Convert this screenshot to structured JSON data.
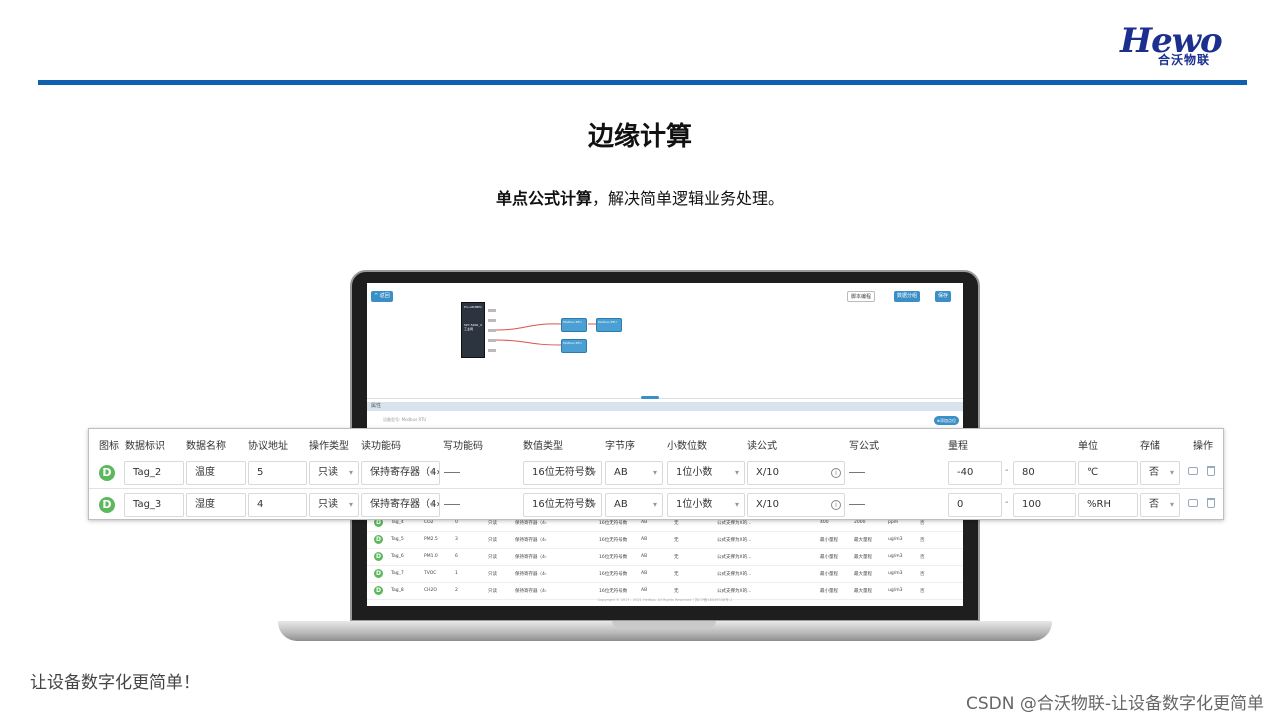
{
  "logo": {
    "mark": "Hewo",
    "name": "合沃物联"
  },
  "title": "边缘计算",
  "subtitle": {
    "bold": "单点公式计算",
    "rest": "，解决简单逻辑业务处理。"
  },
  "footer": {
    "left": "让设备数字化更简单！",
    "right": "CSDN @合沃物联-让设备数字化更简单"
  },
  "screen": {
    "buttons": {
      "back": "^ 返回",
      "script": "脚本编程",
      "data": "数据分组",
      "save": "保存"
    },
    "device": {
      "model": "Pro-AD2BP1",
      "label": "SP7-5400_4 工业网"
    },
    "nodes": [
      "Modbus RTU",
      "Modbus RTU",
      "Modbus RTU"
    ],
    "property_bar": "属性",
    "property_row": "设备型号:  Modbus RTU",
    "property_button": "⊕添加点位",
    "rows": [
      {
        "tag": "Tag_4",
        "name": "CO2",
        "addr": "0",
        "op": "只读",
        "read": "保持寄存器（4›",
        "type": "16位无符号数",
        "order": "AB",
        "dec": "无",
        "formula": "公式支撑为X的...",
        "min": "400",
        "max": "2000",
        "unit": "ppm",
        "store": "否"
      },
      {
        "tag": "Tag_5",
        "name": "PM2.5",
        "addr": "3",
        "op": "只读",
        "read": "保持寄存器（4›",
        "type": "16位无符号数",
        "order": "AB",
        "dec": "无",
        "formula": "公式支撑为X的...",
        "min": "最小量程",
        "max": "最大量程",
        "unit": "ug/m3",
        "store": "否"
      },
      {
        "tag": "Tag_6",
        "name": "PM1.0",
        "addr": "6",
        "op": "只读",
        "read": "保持寄存器（4›",
        "type": "16位无符号数",
        "order": "AB",
        "dec": "无",
        "formula": "公式支撑为X的...",
        "min": "最小量程",
        "max": "最大量程",
        "unit": "ug/m3",
        "store": "否"
      },
      {
        "tag": "Tag_7",
        "name": "TVOC",
        "addr": "1",
        "op": "只读",
        "read": "保持寄存器（4›",
        "type": "16位无符号数",
        "order": "AB",
        "dec": "无",
        "formula": "公式支撑为X的...",
        "min": "最小量程",
        "max": "最大量程",
        "unit": "ug/m3",
        "store": "否"
      },
      {
        "tag": "Tag_8",
        "name": "CH2O",
        "addr": "2",
        "op": "只读",
        "read": "保持寄存器（4›",
        "type": "16位无符号数",
        "order": "AB",
        "dec": "无",
        "formula": "公式支撑为X的...",
        "min": "最小量程",
        "max": "最大量程",
        "unit": "ug/m3",
        "store": "否"
      }
    ],
    "copyright": "Copyright © 2017 - 2021 HeWoo. All Rights Reserved | 苏ICP备18049338号-1"
  },
  "table": {
    "headers": [
      "图标",
      "数据标识",
      "数据名称",
      "协议地址",
      "操作类型",
      "读功能码",
      "写功能码",
      "数值类型",
      "字节序",
      "小数位数",
      "读公式",
      "写公式",
      "量程",
      "单位",
      "存储",
      "操作"
    ],
    "rows": [
      {
        "icon": "D",
        "tag": "Tag_2",
        "name": "温度",
        "addr": "5",
        "op": "只读",
        "read": "保持寄存器（4›",
        "type": "16位无符号数",
        "order": "AB",
        "dec": "1位小数",
        "formula": "X/10",
        "min": "-40",
        "max": "80",
        "unit": "℃",
        "store": "否"
      },
      {
        "icon": "D",
        "tag": "Tag_3",
        "name": "湿度",
        "addr": "4",
        "op": "只读",
        "read": "保持寄存器（4›",
        "type": "16位无符号数",
        "order": "AB",
        "dec": "1位小数",
        "formula": "X/10",
        "min": "0",
        "max": "100",
        "unit": "%RH",
        "store": "否"
      }
    ],
    "range_separator": "-",
    "status_color": "#5cb85c",
    "accent_color": "#1060b0"
  }
}
